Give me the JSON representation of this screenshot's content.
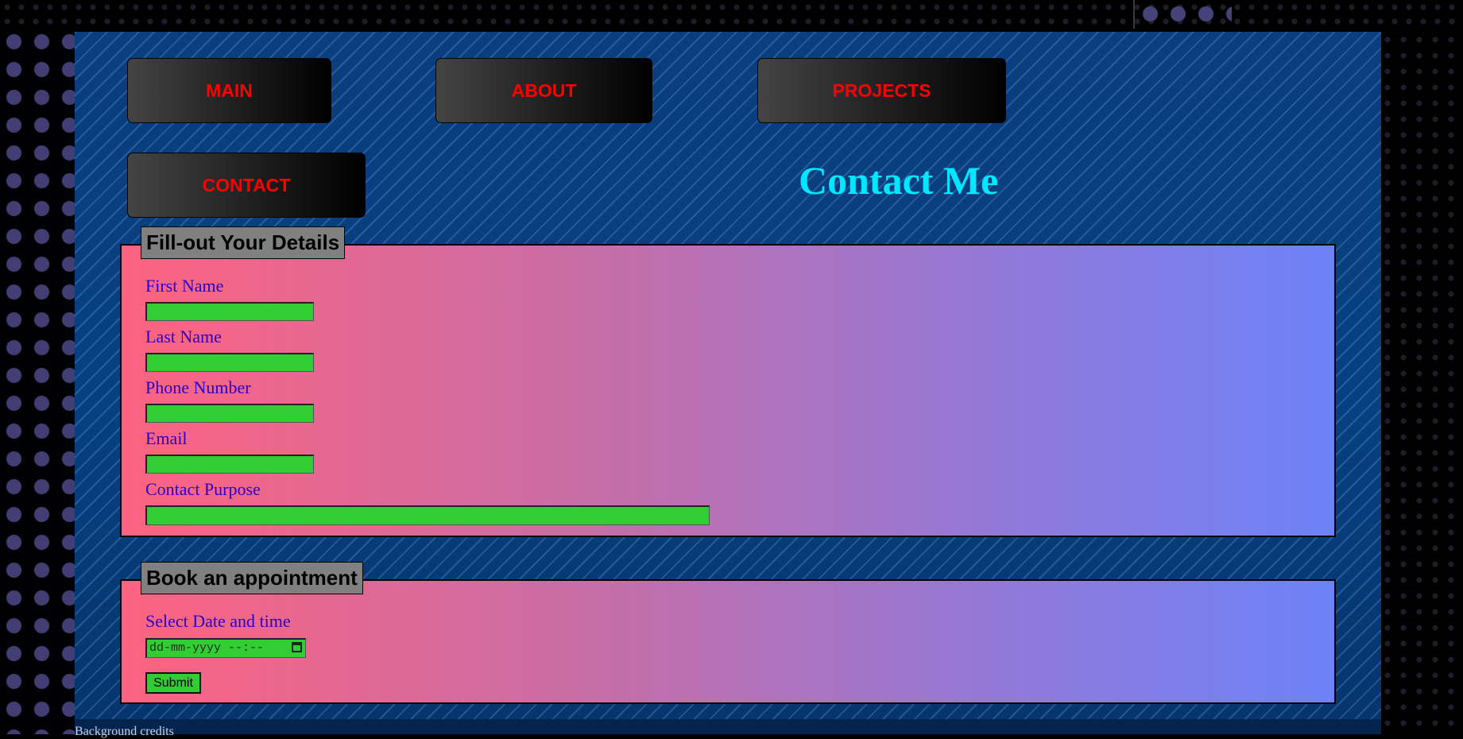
{
  "nav": {
    "main": "MAIN",
    "about": "ABOUT",
    "projects": "PROJECTS",
    "contact": "CONTACT"
  },
  "page_title": "Contact Me",
  "details_form": {
    "legend": "Fill-out Your Details",
    "fields": [
      {
        "label": "First Name",
        "value": ""
      },
      {
        "label": "Last Name",
        "value": ""
      },
      {
        "label": "Phone Number",
        "value": ""
      },
      {
        "label": "Email",
        "value": ""
      },
      {
        "label": "Contact Purpose",
        "value": ""
      }
    ]
  },
  "appointment_form": {
    "legend": "Book an appointment",
    "label": "Select Date and time",
    "datetime_placeholder": "dd-mm-yyyy --:--",
    "submit_label": "Submit"
  },
  "footer": {
    "text": "Background credits"
  },
  "colors": {
    "nav_text": "#ff0000",
    "title": "#00e7ff",
    "input_bg": "#32cd32",
    "label_text": "#2a00c8",
    "legend_bg": "#808080"
  },
  "icons": [
    "calendar-icon"
  ]
}
